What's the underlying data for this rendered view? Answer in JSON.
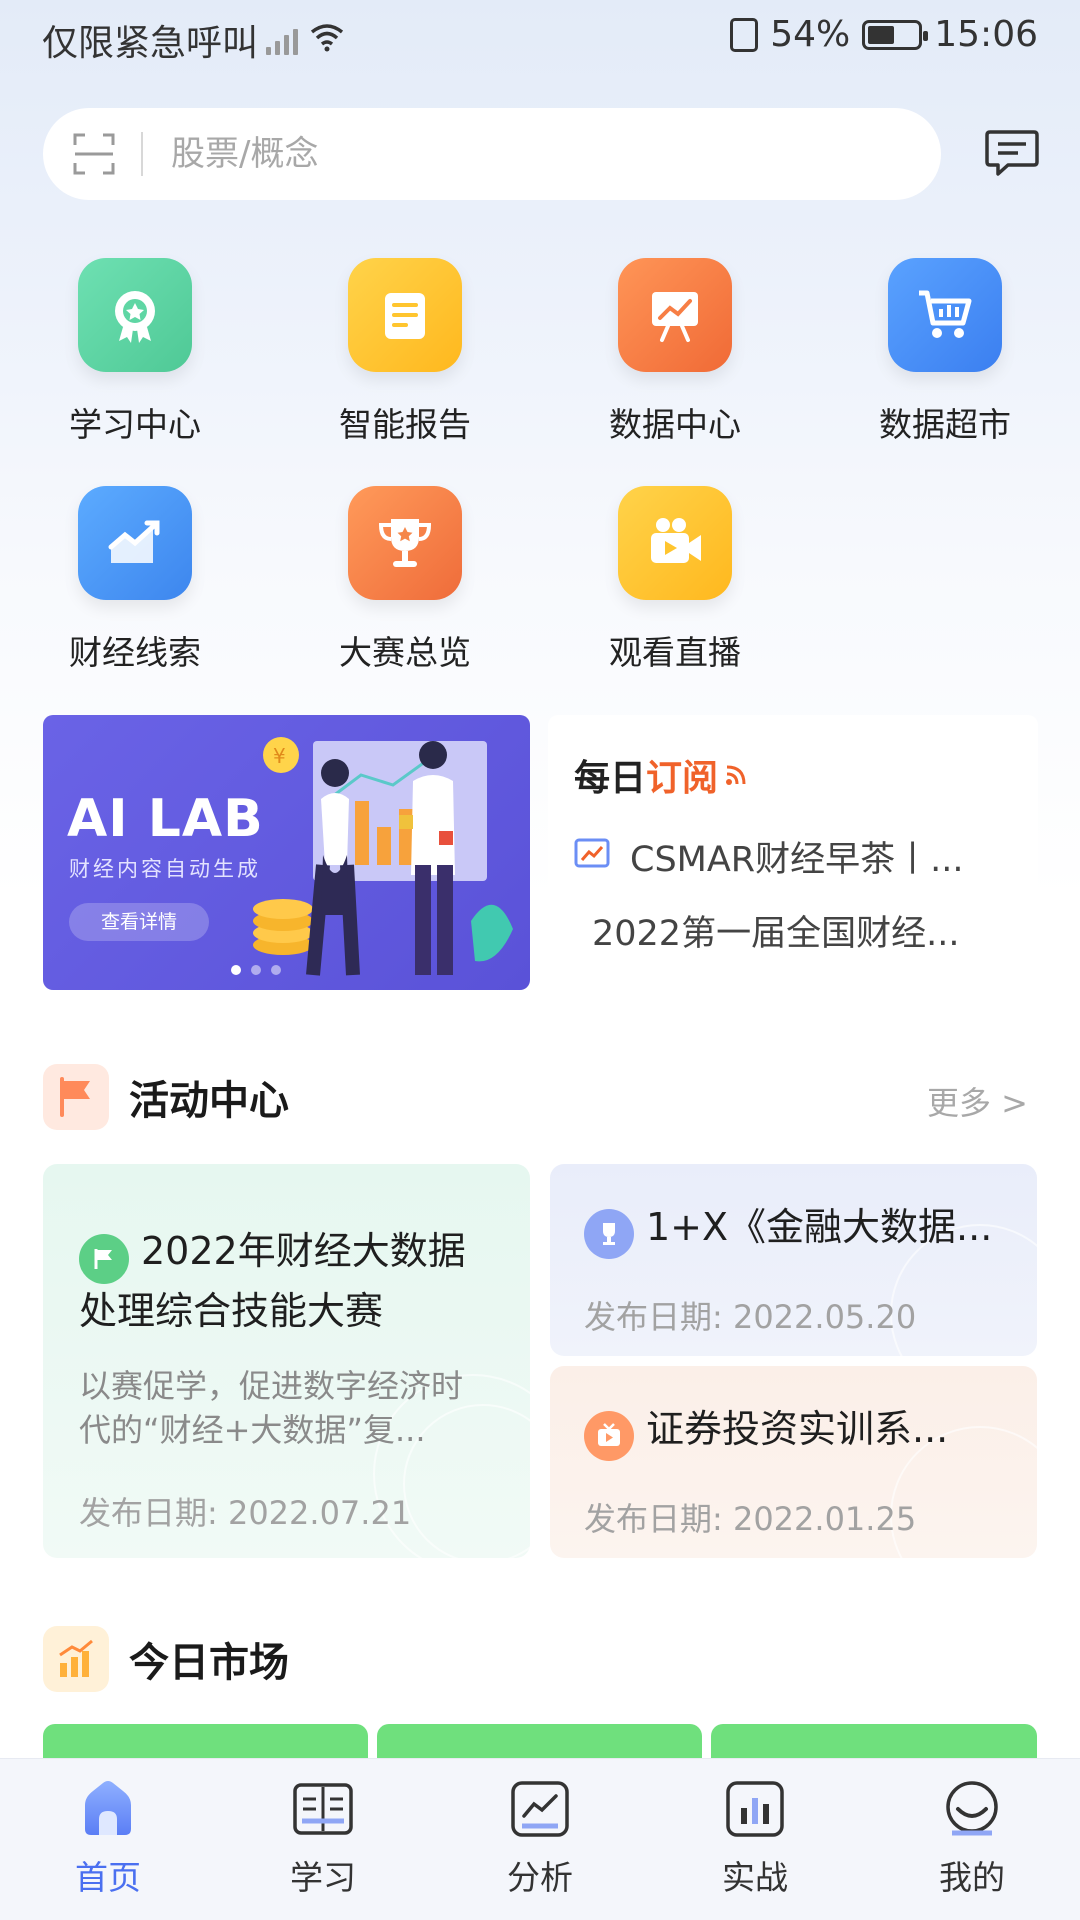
{
  "status_bar": {
    "carrier": "仅限紧急呼叫",
    "battery": "54%",
    "battery_level": 0.54,
    "time": "15:06"
  },
  "search": {
    "placeholder": "股票/概念"
  },
  "grid": [
    {
      "label": "学习中心",
      "icon": "ribbon-badge-icon",
      "color": "#5fd6a4"
    },
    {
      "label": "智能报告",
      "icon": "report-icon",
      "color": "#ffc52e"
    },
    {
      "label": "数据中心",
      "icon": "presentation-chart-icon",
      "color": "#f77e45"
    },
    {
      "label": "数据超市",
      "icon": "shopping-cart-icon",
      "color": "#4a8ff5"
    },
    {
      "label": "财经线索",
      "icon": "trend-chart-icon",
      "color": "#4d9bf5"
    },
    {
      "label": "大赛总览",
      "icon": "trophy-icon",
      "color": "#f5874a"
    },
    {
      "label": "观看直播",
      "icon": "video-camera-icon",
      "color": "#ffc52e"
    }
  ],
  "banner": {
    "title": "AI LAB",
    "subtitle": "财经内容自动生成",
    "button": "查看详情"
  },
  "daily": {
    "title_a": "每日",
    "title_b": "订阅",
    "items": [
      "CSMAR财经早茶丨...",
      "2022第一届全国财经..."
    ]
  },
  "activity": {
    "title": "活动中心",
    "more": "更多 >",
    "cards": [
      {
        "title": "2022年财经大数据处理综合技能大赛",
        "desc": "以赛促学，促进数字经济时代的“财经+大数据”复...",
        "date": "发布日期: 2022.07.21"
      },
      {
        "title": "1+X《金融大数据...",
        "date": "发布日期: 2022.05.20"
      },
      {
        "title": "证券投资实训系...",
        "date": "发布日期: 2022.01.25"
      }
    ]
  },
  "market": {
    "title": "今日市场"
  },
  "nav": [
    {
      "label": "首页",
      "icon": "home-icon"
    },
    {
      "label": "学习",
      "icon": "book-icon"
    },
    {
      "label": "分析",
      "icon": "analysis-chart-icon"
    },
    {
      "label": "实战",
      "icon": "bar-chart-icon"
    },
    {
      "label": "我的",
      "icon": "profile-icon"
    }
  ],
  "colors": {
    "accent": "#4a6ff0",
    "orange": "#f0622a",
    "market_green": "#6fe07d"
  }
}
